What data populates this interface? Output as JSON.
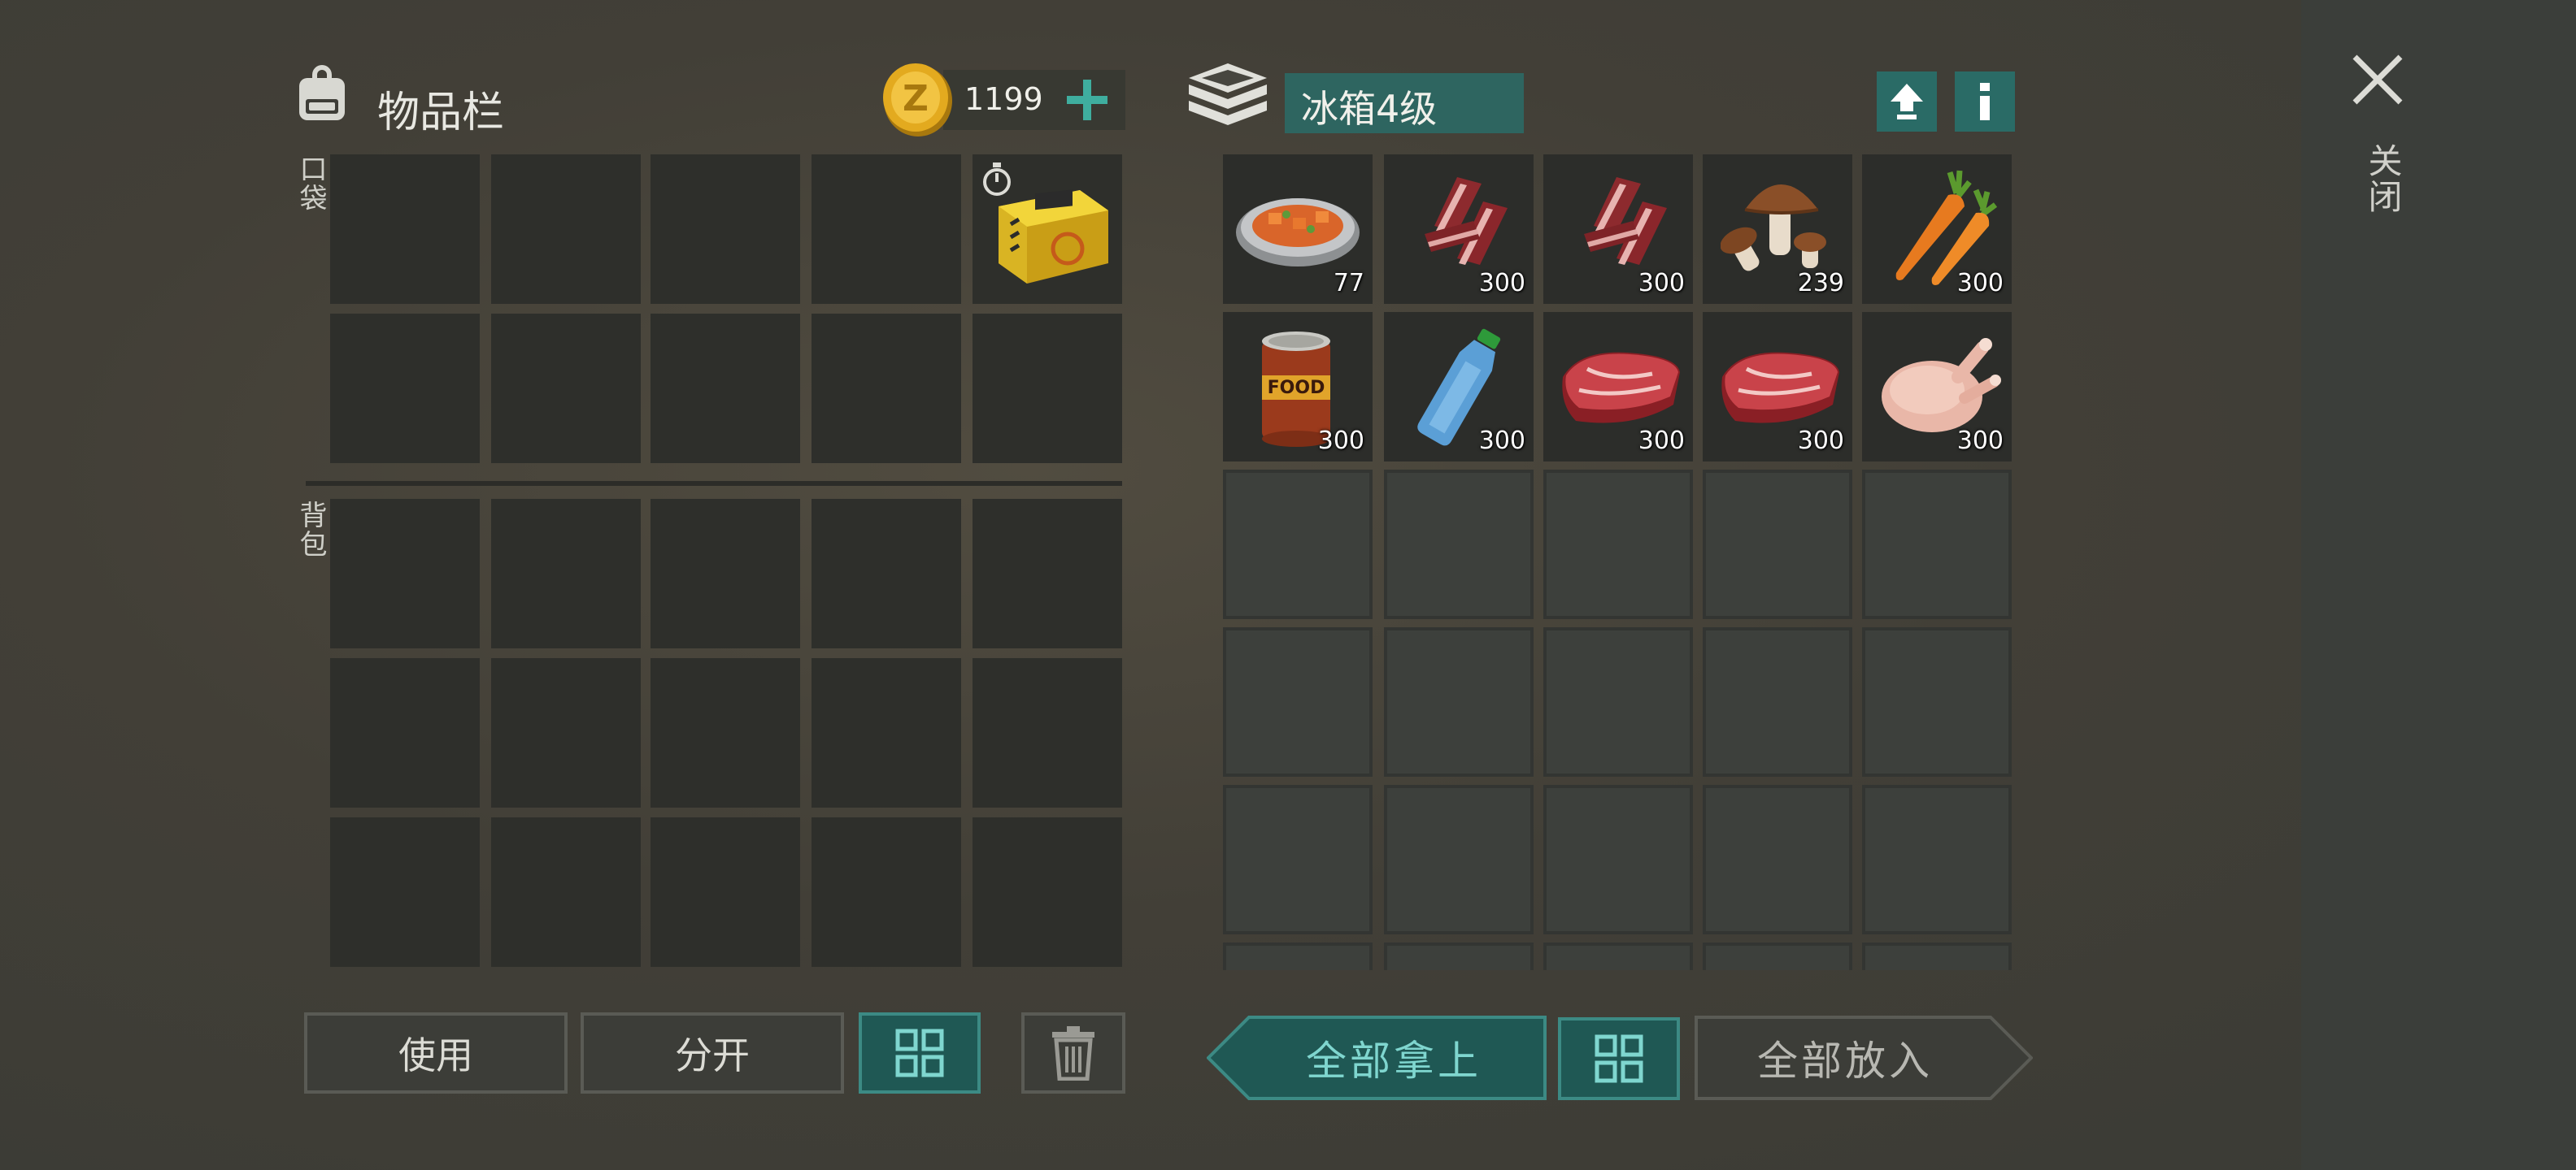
{
  "inventory": {
    "title": "物品栏",
    "coins": "1199",
    "pocket_label": "口袋",
    "backpack_label": "背包"
  },
  "container": {
    "name": "冰箱4级",
    "items": [
      {
        "icon": "cooked-stew-icon",
        "count": "77"
      },
      {
        "icon": "raw-bacon-icon",
        "count": "300"
      },
      {
        "icon": "raw-bacon-icon",
        "count": "300"
      },
      {
        "icon": "mushroom-icon",
        "count": "239"
      },
      {
        "icon": "carrot-icon",
        "count": "300"
      },
      {
        "icon": "canned-food-icon",
        "count": "300",
        "label": "FOOD"
      },
      {
        "icon": "water-bottle-icon",
        "count": "300"
      },
      {
        "icon": "raw-steak-icon",
        "count": "300"
      },
      {
        "icon": "raw-steak-icon",
        "count": "300"
      },
      {
        "icon": "raw-chicken-icon",
        "count": "300"
      }
    ]
  },
  "buttons": {
    "use": "使用",
    "split": "分开",
    "take_all": "全部拿上",
    "put_all": "全部放入"
  },
  "close_label": "关闭",
  "colors": {
    "accent_teal": "#2a6b66",
    "teal_text": "#7fd6cf",
    "coin_gold": "#e0a81c"
  }
}
